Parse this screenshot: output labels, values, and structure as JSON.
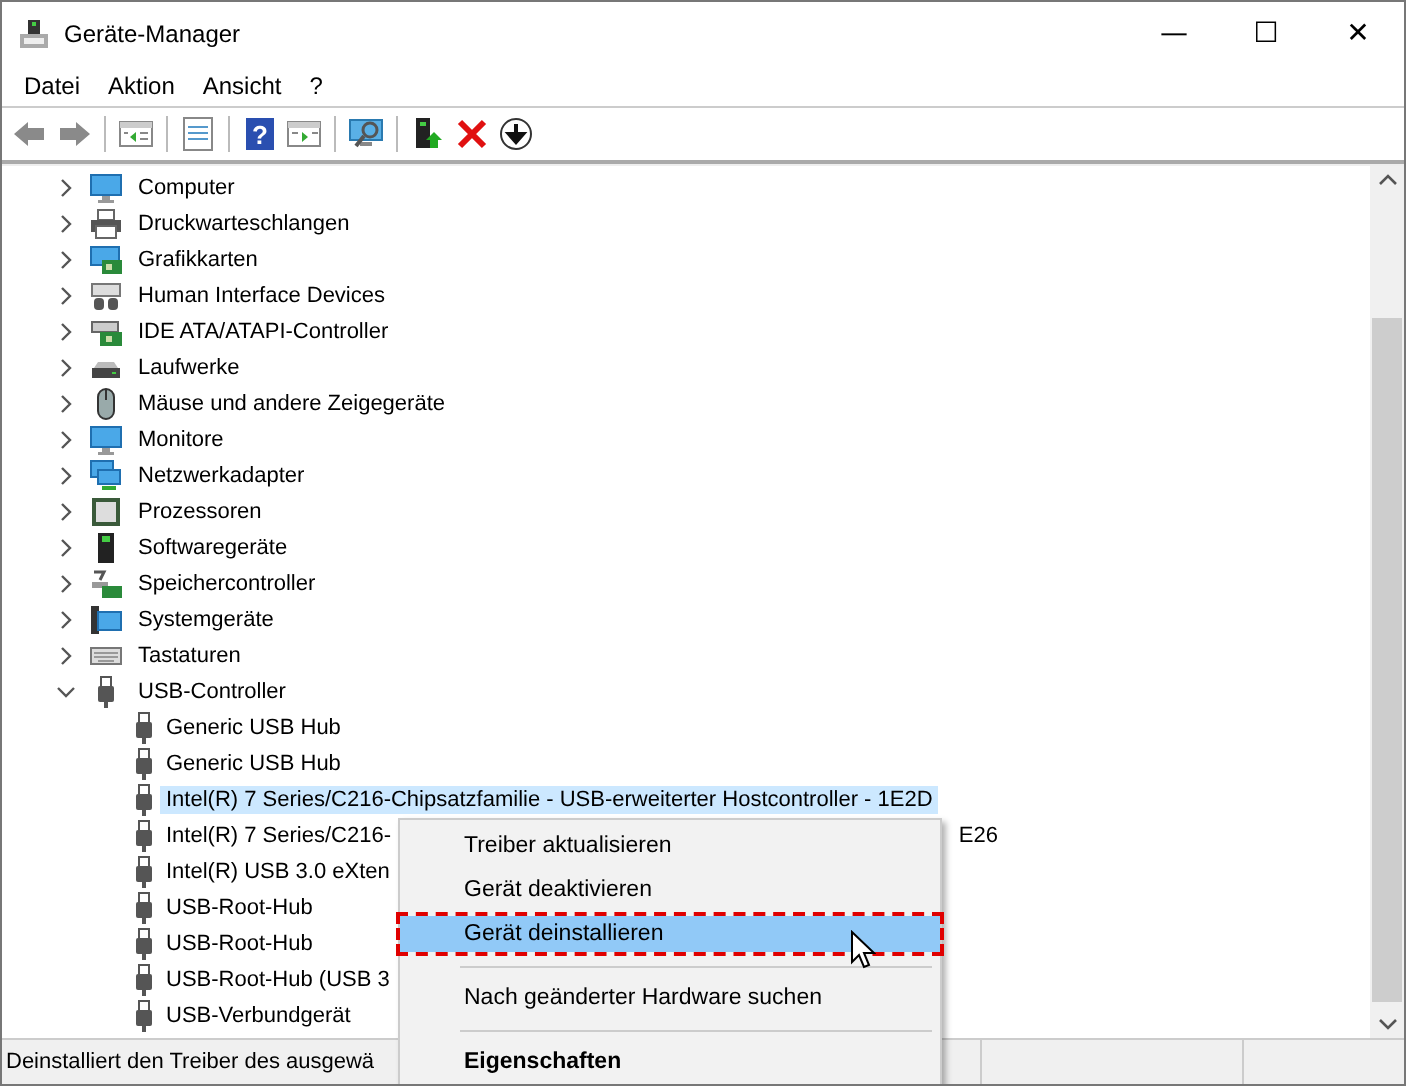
{
  "window": {
    "title": "Geräte-Manager",
    "controls": [
      "—",
      "☐",
      "✕"
    ]
  },
  "menu": [
    "Datei",
    "Aktion",
    "Ansicht",
    "?"
  ],
  "toolbar": [
    {
      "kind": "back",
      "disabled": false
    },
    {
      "kind": "forward",
      "disabled": false
    },
    {
      "kind": "sep"
    },
    {
      "kind": "tree"
    },
    {
      "kind": "sep"
    },
    {
      "kind": "props"
    },
    {
      "kind": "sep"
    },
    {
      "kind": "help",
      "glyph": "?"
    },
    {
      "kind": "pane"
    },
    {
      "kind": "sep"
    },
    {
      "kind": "scan"
    },
    {
      "kind": "sep"
    },
    {
      "kind": "driver"
    },
    {
      "kind": "uninstall"
    },
    {
      "kind": "download"
    }
  ],
  "tree": [
    {
      "label": "Computer",
      "expanded": false
    },
    {
      "label": "Druckwarteschlangen",
      "expanded": false
    },
    {
      "label": "Grafikkarten",
      "expanded": false
    },
    {
      "label": "Human Interface Devices",
      "expanded": false
    },
    {
      "label": "IDE ATA/ATAPI-Controller",
      "expanded": false
    },
    {
      "label": "Laufwerke",
      "expanded": false
    },
    {
      "label": "Mäuse und andere Zeigegeräte",
      "expanded": false
    },
    {
      "label": "Monitore",
      "expanded": false
    },
    {
      "label": "Netzwerkadapter",
      "expanded": false
    },
    {
      "label": "Prozessoren",
      "expanded": false
    },
    {
      "label": "Softwaregeräte",
      "expanded": false
    },
    {
      "label": "Speichercontroller",
      "expanded": false
    },
    {
      "label": "Systemgeräte",
      "expanded": false
    },
    {
      "label": "Tastaturen",
      "expanded": false
    },
    {
      "label": "USB-Controller",
      "expanded": true,
      "children": [
        {
          "label": "Generic USB Hub",
          "selected": false
        },
        {
          "label": "Generic USB Hub",
          "selected": false
        },
        {
          "label": "Intel(R) 7 Series/C216-Chipsatzfamilie - USB-erweiterter Hostcontroller - 1E2D",
          "selected": true
        },
        {
          "label": "Intel(R) 7 Series/C216-",
          "tail": "E26",
          "selected": false
        },
        {
          "label": "Intel(R) USB 3.0 eXten",
          "selected": false
        },
        {
          "label": "USB-Root-Hub",
          "selected": false
        },
        {
          "label": "USB-Root-Hub",
          "selected": false
        },
        {
          "label": "USB-Root-Hub (USB 3",
          "selected": false
        },
        {
          "label": "USB-Verbundgerät",
          "selected": false
        }
      ]
    }
  ],
  "context_menu": [
    {
      "kind": "item",
      "label": "Treiber aktualisieren",
      "selected": false,
      "marked": false
    },
    {
      "kind": "item",
      "label": "Gerät deaktivieren",
      "selected": false,
      "marked": false
    },
    {
      "kind": "item",
      "label": "Gerät deinstallieren",
      "selected": true,
      "marked": true
    },
    {
      "kind": "separator"
    },
    {
      "kind": "item",
      "label": "Nach geänderter Hardware suchen",
      "selected": false,
      "marked": false
    },
    {
      "kind": "separator"
    },
    {
      "kind": "default",
      "label": "Eigenschaften",
      "selected": false,
      "marked": false
    }
  ],
  "status_bar": "Deinstalliert den Treiber des ausgewä"
}
